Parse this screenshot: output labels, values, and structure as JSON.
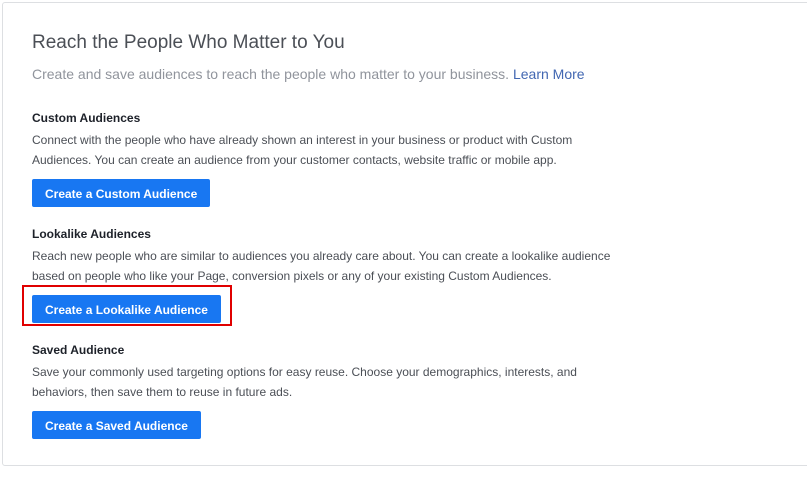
{
  "header": {
    "title": "Reach the People Who Matter to You",
    "subtitle": "Create and save audiences to reach the people who matter to your business.",
    "learn_more": "Learn More"
  },
  "sections": [
    {
      "heading": "Custom Audiences",
      "description": "Connect with the people who have already shown an interest in your business or product with Custom Audiences. You can create an audience from your customer contacts, website traffic or mobile app.",
      "button_label": "Create a Custom Audience"
    },
    {
      "heading": "Lookalike Audiences",
      "description": "Reach new people who are similar to audiences you already care about. You can create a lookalike audience based on people who like your Page, conversion pixels or any of your existing Custom Audiences.",
      "button_label": "Create a Lookalike Audience",
      "highlighted": true
    },
    {
      "heading": "Saved Audience",
      "description": "Save your commonly used targeting options for easy reuse. Choose your demographics, interests, and behaviors, then save them to reuse in future ads.",
      "button_label": "Create a Saved Audience"
    }
  ],
  "colors": {
    "button": "#1877f2",
    "link": "#4267b2",
    "highlight_box": "#e00000"
  }
}
